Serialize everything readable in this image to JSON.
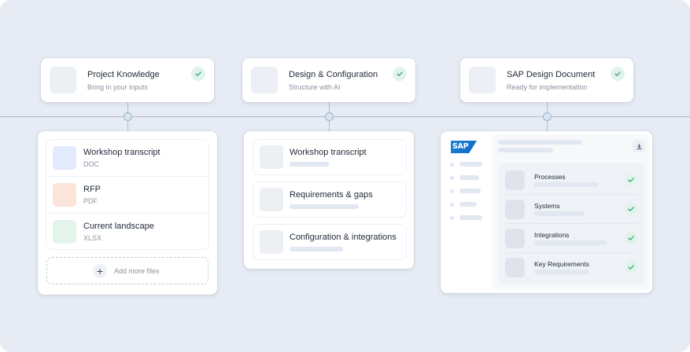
{
  "steps": [
    {
      "title": "Project Knowledge",
      "subtitle": "Bring in your inputs"
    },
    {
      "title": "Design & Configuration",
      "subtitle": "Structure with AI"
    },
    {
      "title": "SAP Design Document",
      "subtitle": "Ready for implementation"
    }
  ],
  "files": [
    {
      "name": "Workshop transcript",
      "type": "DOC",
      "color": "#e2eafd"
    },
    {
      "name": "RFP",
      "type": "PDF",
      "color": "#fbe4da"
    },
    {
      "name": "Current landscape",
      "type": "XLSX",
      "color": "#e3f4ea"
    }
  ],
  "add_files_label": "Add more files",
  "design_sections": [
    {
      "name": "Workshop transcript"
    },
    {
      "name": "Requirements & gaps"
    },
    {
      "name": "Configuration & integrations"
    }
  ],
  "sap_logo": "SAP",
  "document_items": [
    {
      "name": "Processes"
    },
    {
      "name": "Systems"
    },
    {
      "name": "Integrations"
    },
    {
      "name": "Key Requirements"
    }
  ],
  "colors": {
    "background": "#e7ebf3",
    "connector": "#a9bfd6",
    "check_bg": "#e2f3ec",
    "check_mark": "#3fae7f",
    "sap_blue": "#0d66c2"
  },
  "icons": {
    "step_status": "check-icon",
    "add": "plus-icon",
    "download": "download-icon"
  }
}
